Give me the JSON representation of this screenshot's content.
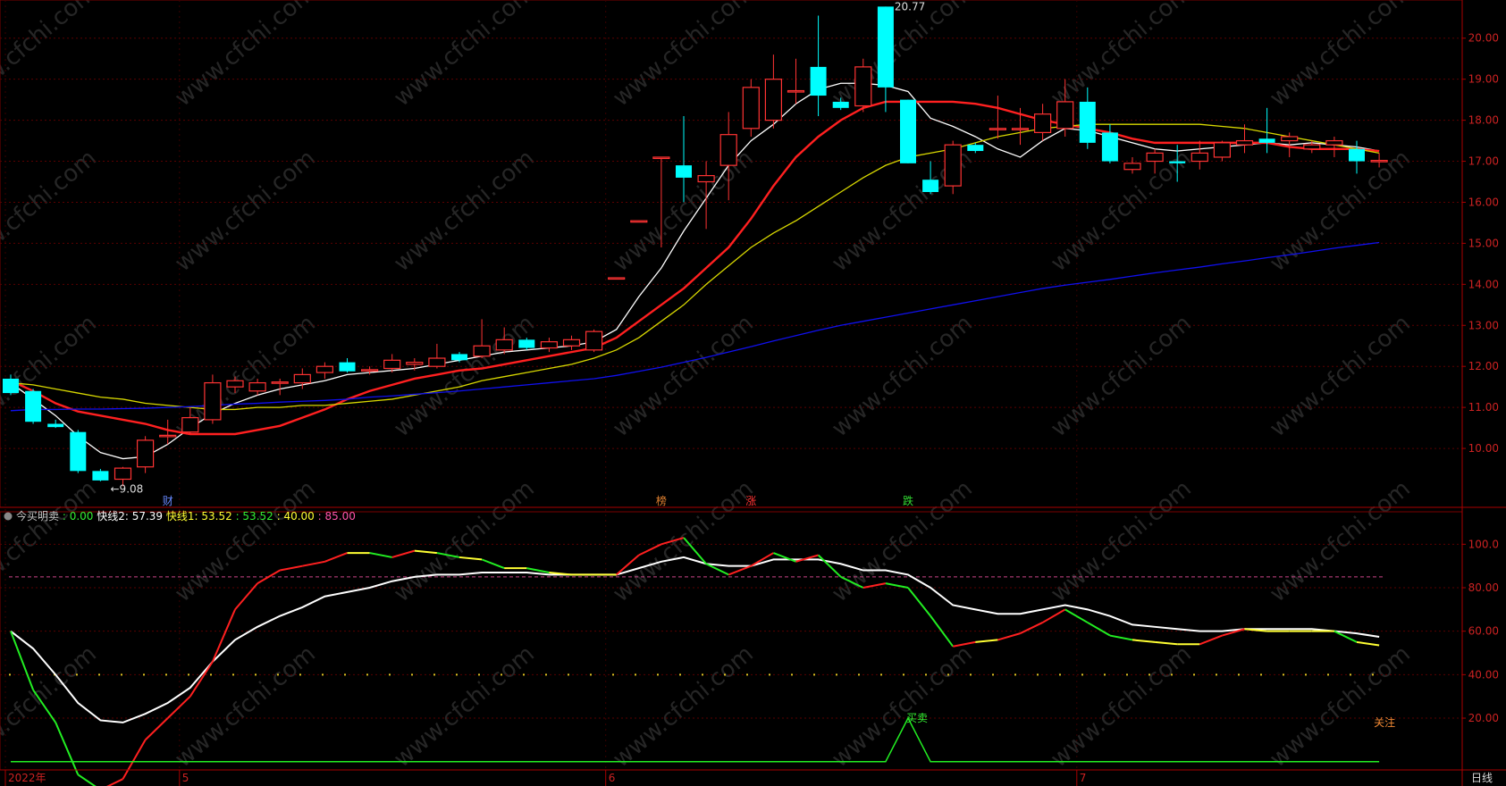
{
  "watermark": "www.cfchi.com",
  "chart_data": [
    {
      "type": "candlestick",
      "yaxis": {
        "ticks": [
          "20.00",
          "19.00",
          "18.00",
          "17.00",
          "16.00",
          "15.00",
          "14.00",
          "13.00",
          "12.00",
          "11.00",
          "10.00"
        ],
        "range": [
          9.0,
          20.8
        ]
      },
      "up_color": "#ff3333",
      "down_color": "#00ffff",
      "candles": [
        {
          "o": 11.7,
          "h": 11.8,
          "l": 11.3,
          "c": 11.35
        },
        {
          "o": 11.4,
          "h": 11.45,
          "l": 10.6,
          "c": 10.65
        },
        {
          "o": 10.6,
          "h": 10.7,
          "l": 10.5,
          "c": 10.52
        },
        {
          "o": 10.4,
          "h": 10.45,
          "l": 9.4,
          "c": 9.45
        },
        {
          "o": 9.45,
          "h": 9.5,
          "l": 9.2,
          "c": 9.22
        },
        {
          "o": 9.25,
          "h": 9.55,
          "l": 9.08,
          "c": 9.52
        },
        {
          "o": 9.55,
          "h": 10.3,
          "l": 9.4,
          "c": 10.2
        },
        {
          "o": 10.3,
          "h": 10.7,
          "l": 10.1,
          "c": 10.32
        },
        {
          "o": 10.4,
          "h": 11.0,
          "l": 10.35,
          "c": 10.75
        },
        {
          "o": 10.7,
          "h": 11.8,
          "l": 10.6,
          "c": 11.6
        },
        {
          "o": 11.5,
          "h": 11.75,
          "l": 11.35,
          "c": 11.65
        },
        {
          "o": 11.4,
          "h": 11.7,
          "l": 11.3,
          "c": 11.6
        },
        {
          "o": 11.6,
          "h": 11.7,
          "l": 11.3,
          "c": 11.62
        },
        {
          "o": 11.6,
          "h": 11.95,
          "l": 11.45,
          "c": 11.8
        },
        {
          "o": 11.85,
          "h": 12.1,
          "l": 11.7,
          "c": 12.0
        },
        {
          "o": 12.1,
          "h": 12.2,
          "l": 11.85,
          "c": 11.88
        },
        {
          "o": 11.9,
          "h": 12.0,
          "l": 11.8,
          "c": 11.92
        },
        {
          "o": 11.95,
          "h": 12.3,
          "l": 11.85,
          "c": 12.15
        },
        {
          "o": 12.05,
          "h": 12.2,
          "l": 11.9,
          "c": 12.1
        },
        {
          "o": 12.0,
          "h": 12.55,
          "l": 11.95,
          "c": 12.2
        },
        {
          "o": 12.3,
          "h": 12.35,
          "l": 12.1,
          "c": 12.15
        },
        {
          "o": 12.25,
          "h": 13.15,
          "l": 12.2,
          "c": 12.5
        },
        {
          "o": 12.4,
          "h": 12.95,
          "l": 12.3,
          "c": 12.65
        },
        {
          "o": 12.65,
          "h": 12.7,
          "l": 12.4,
          "c": 12.45
        },
        {
          "o": 12.45,
          "h": 12.7,
          "l": 12.35,
          "c": 12.6
        },
        {
          "o": 12.5,
          "h": 12.75,
          "l": 12.4,
          "c": 12.65
        },
        {
          "o": 12.4,
          "h": 12.9,
          "l": 12.35,
          "c": 12.85
        },
        {
          "o": 14.16,
          "h": 14.16,
          "l": 14.16,
          "c": 14.16
        },
        {
          "o": 15.55,
          "h": 15.55,
          "l": 15.55,
          "c": 15.55
        },
        {
          "o": 17.1,
          "h": 17.1,
          "l": 14.9,
          "c": 17.1
        },
        {
          "o": 16.9,
          "h": 18.1,
          "l": 16.0,
          "c": 16.6
        },
        {
          "o": 16.5,
          "h": 17.0,
          "l": 15.35,
          "c": 16.65
        },
        {
          "o": 16.9,
          "h": 18.2,
          "l": 16.05,
          "c": 17.65
        },
        {
          "o": 17.8,
          "h": 19.0,
          "l": 17.6,
          "c": 18.8
        },
        {
          "o": 18.0,
          "h": 19.6,
          "l": 17.8,
          "c": 19.0
        },
        {
          "o": 18.7,
          "h": 19.5,
          "l": 18.4,
          "c": 18.72
        },
        {
          "o": 19.3,
          "h": 20.55,
          "l": 18.1,
          "c": 18.6
        },
        {
          "o": 18.45,
          "h": 18.55,
          "l": 18.25,
          "c": 18.3
        },
        {
          "o": 18.35,
          "h": 19.5,
          "l": 18.2,
          "c": 19.3
        },
        {
          "o": 20.77,
          "h": 20.77,
          "l": 18.2,
          "c": 18.8
        },
        {
          "o": 18.5,
          "h": 18.5,
          "l": 16.95,
          "c": 16.95
        },
        {
          "o": 16.55,
          "h": 17.0,
          "l": 16.2,
          "c": 16.25
        },
        {
          "o": 16.4,
          "h": 17.5,
          "l": 16.2,
          "c": 17.4
        },
        {
          "o": 17.4,
          "h": 17.45,
          "l": 17.2,
          "c": 17.25
        },
        {
          "o": 17.8,
          "h": 18.6,
          "l": 17.55,
          "c": 17.8
        },
        {
          "o": 17.8,
          "h": 18.3,
          "l": 17.4,
          "c": 17.8
        },
        {
          "o": 17.7,
          "h": 18.4,
          "l": 17.5,
          "c": 18.15
        },
        {
          "o": 17.8,
          "h": 19.0,
          "l": 17.6,
          "c": 18.45
        },
        {
          "o": 18.45,
          "h": 18.8,
          "l": 17.3,
          "c": 17.45
        },
        {
          "o": 17.7,
          "h": 17.9,
          "l": 16.95,
          "c": 17.0
        },
        {
          "o": 16.8,
          "h": 17.1,
          "l": 16.7,
          "c": 16.95
        },
        {
          "o": 17.0,
          "h": 17.3,
          "l": 16.7,
          "c": 17.2
        },
        {
          "o": 17.0,
          "h": 17.4,
          "l": 16.5,
          "c": 16.95
        },
        {
          "o": 17.0,
          "h": 17.5,
          "l": 16.8,
          "c": 17.2
        },
        {
          "o": 17.1,
          "h": 17.5,
          "l": 17.0,
          "c": 17.45
        },
        {
          "o": 17.4,
          "h": 17.9,
          "l": 17.2,
          "c": 17.5
        },
        {
          "o": 17.55,
          "h": 18.3,
          "l": 17.2,
          "c": 17.45
        },
        {
          "o": 17.5,
          "h": 17.7,
          "l": 17.1,
          "c": 17.6
        },
        {
          "o": 17.3,
          "h": 17.5,
          "l": 17.2,
          "c": 17.4
        },
        {
          "o": 17.4,
          "h": 17.6,
          "l": 17.1,
          "c": 17.5
        },
        {
          "o": 17.3,
          "h": 17.5,
          "l": 16.7,
          "c": 17.0
        },
        {
          "o": 17.0,
          "h": 17.2,
          "l": 16.85,
          "c": 17.02
        }
      ],
      "series": [
        {
          "color": "#ffffff",
          "values": [
            11.6,
            11.2,
            10.8,
            10.3,
            9.9,
            9.75,
            9.8,
            10.1,
            10.5,
            10.85,
            11.1,
            11.3,
            11.45,
            11.55,
            11.65,
            11.8,
            11.85,
            11.9,
            11.95,
            12.05,
            12.15,
            12.25,
            12.35,
            12.4,
            12.45,
            12.5,
            12.6,
            12.9,
            13.7,
            14.4,
            15.3,
            16.1,
            16.9,
            17.5,
            17.9,
            18.4,
            18.75,
            18.9,
            18.9,
            18.85,
            18.7,
            18.05,
            17.85,
            17.6,
            17.3,
            17.1,
            17.5,
            17.8,
            17.75,
            17.6,
            17.45,
            17.3,
            17.25,
            17.3,
            17.35,
            17.4,
            17.45,
            17.4,
            17.45,
            17.4,
            17.35,
            17.25
          ]
        },
        {
          "color": "#ff2020",
          "values": [
            11.65,
            11.4,
            11.1,
            10.9,
            10.8,
            10.7,
            10.6,
            10.45,
            10.35,
            10.35,
            10.35,
            10.45,
            10.55,
            10.75,
            10.95,
            11.2,
            11.4,
            11.55,
            11.7,
            11.8,
            11.9,
            11.95,
            12.05,
            12.15,
            12.25,
            12.35,
            12.45,
            12.7,
            13.1,
            13.5,
            13.9,
            14.4,
            14.9,
            15.6,
            16.4,
            17.1,
            17.6,
            18.0,
            18.3,
            18.45,
            18.45,
            18.45,
            18.45,
            18.4,
            18.3,
            18.15,
            18.0,
            17.9,
            17.8,
            17.7,
            17.55,
            17.45,
            17.45,
            17.45,
            17.45,
            17.45,
            17.45,
            17.35,
            17.3,
            17.3,
            17.3,
            17.25
          ]
        },
        {
          "color": "#d8d800",
          "values": [
            11.6,
            11.55,
            11.45,
            11.35,
            11.25,
            11.2,
            11.1,
            11.05,
            11.0,
            10.95,
            10.95,
            11.0,
            11.0,
            11.05,
            11.05,
            11.1,
            11.15,
            11.2,
            11.3,
            11.4,
            11.5,
            11.65,
            11.75,
            11.85,
            11.95,
            12.05,
            12.2,
            12.4,
            12.7,
            13.1,
            13.5,
            14.0,
            14.45,
            14.9,
            15.25,
            15.55,
            15.9,
            16.25,
            16.6,
            16.9,
            17.1,
            17.2,
            17.3,
            17.45,
            17.6,
            17.7,
            17.8,
            17.85,
            17.9,
            17.9,
            17.9,
            17.9,
            17.9,
            17.9,
            17.85,
            17.8,
            17.7,
            17.6,
            17.5,
            17.4,
            17.3,
            17.2
          ]
        },
        {
          "color": "#1010ee",
          "values": [
            10.92,
            10.95,
            10.95,
            10.96,
            10.96,
            10.97,
            10.98,
            11.0,
            11.02,
            11.05,
            11.08,
            11.1,
            11.13,
            11.15,
            11.17,
            11.2,
            11.25,
            11.28,
            11.32,
            11.36,
            11.4,
            11.45,
            11.5,
            11.55,
            11.6,
            11.65,
            11.7,
            11.78,
            11.88,
            11.98,
            12.1,
            12.22,
            12.35,
            12.48,
            12.62,
            12.75,
            12.88,
            13.0,
            13.1,
            13.2,
            13.3,
            13.4,
            13.5,
            13.6,
            13.7,
            13.8,
            13.9,
            13.98,
            14.05,
            14.12,
            14.2,
            14.28,
            14.35,
            14.42,
            14.5,
            14.57,
            14.65,
            14.72,
            14.8,
            14.88,
            14.95,
            15.02
          ]
        }
      ],
      "annotations": [
        {
          "text": "20.77",
          "index": 39,
          "value": 20.77
        },
        {
          "text": "←9.08",
          "index": 5,
          "value": 9.08
        }
      ],
      "event_markers": [
        {
          "text": "财",
          "index": 7,
          "color": "#6688ff"
        },
        {
          "text": "榜",
          "index": 29,
          "color": "#e08030"
        },
        {
          "text": "涨",
          "index": 33,
          "color": "#ff3333"
        },
        {
          "text": "跌",
          "index": 40,
          "color": "#33dd33"
        }
      ]
    },
    {
      "type": "line",
      "title": "今买明卖",
      "legend": [
        {
          "text": "今买明卖",
          "color": "#c8c8c8"
        },
        {
          "text": ": 0.00",
          "color": "#33ee33"
        },
        {
          "text": "快线2: 57.39",
          "color": "#ffffff"
        },
        {
          "text": "快线1: 53.52",
          "color": "#ffff33"
        },
        {
          "text": ": 53.52",
          "color": "#33ee33"
        },
        {
          "text": ": 40.00",
          "color": "#ffff33"
        },
        {
          "text": ": 85.00",
          "color": "#ff55aa"
        }
      ],
      "yaxis": {
        "ticks": [
          "100.0",
          "80.00",
          "60.00",
          "40.00",
          "20.00"
        ],
        "range": [
          -3,
          110
        ]
      },
      "series": [
        {
          "name": "快线2",
          "color": "#ffffff",
          "values": [
            60,
            52,
            40,
            27,
            19,
            18,
            22,
            27,
            34,
            46,
            56,
            62,
            67,
            71,
            76,
            78,
            80,
            83,
            85,
            86,
            86,
            87,
            87,
            87,
            86,
            86,
            86,
            86,
            89,
            92,
            94,
            91,
            90,
            90,
            93,
            93,
            93,
            91,
            88,
            88,
            86,
            80,
            72,
            70,
            68,
            68,
            70,
            72,
            70,
            67,
            63,
            62,
            61,
            60,
            60,
            61,
            61,
            61,
            61,
            60,
            59,
            57.39
          ]
        },
        {
          "name": "快线1",
          "values": [
            60,
            33,
            18,
            -6,
            -13,
            -8,
            10,
            20,
            30,
            46,
            70,
            82,
            88,
            90,
            92,
            96,
            96,
            94,
            97,
            96,
            94,
            93,
            89,
            89,
            87,
            86,
            86,
            86,
            95,
            100,
            103,
            91,
            86,
            90,
            96,
            92,
            95,
            85,
            80,
            82,
            80,
            67,
            53,
            55,
            56,
            59,
            64,
            70,
            64,
            58,
            56,
            55,
            54,
            54,
            58,
            61,
            60,
            60,
            60,
            60,
            55,
            53.52
          ],
          "segment_colors": {
            "up": "#ff2020",
            "flat": "#ffff33",
            "down": "#22ee22"
          }
        },
        {
          "name": "买卖",
          "color": "#22ee22",
          "values": [
            0,
            0,
            0,
            0,
            0,
            0,
            0,
            0,
            0,
            0,
            0,
            0,
            0,
            0,
            0,
            0,
            0,
            0,
            0,
            0,
            0,
            0,
            0,
            0,
            0,
            0,
            0,
            0,
            0,
            0,
            0,
            0,
            0,
            0,
            0,
            0,
            0,
            0,
            0,
            0,
            20,
            0,
            0,
            0,
            0,
            0,
            0,
            0,
            0,
            0,
            0,
            0,
            0,
            0,
            0,
            0,
            0,
            0,
            0,
            0,
            0,
            0
          ]
        }
      ],
      "reference_lines": [
        {
          "value": 85,
          "color": "#cc4488",
          "style": "dashed"
        },
        {
          "value": 40,
          "color": "#e0c020",
          "style": "dotted"
        }
      ],
      "annotations": [
        {
          "text": "买卖",
          "index": 40,
          "value": 20,
          "color": "#33ee33"
        },
        {
          "text": "关注",
          "index": 61,
          "value": 18,
          "color": "#ee8833"
        }
      ]
    }
  ],
  "xaxis": {
    "labels": [
      {
        "text": "2022年",
        "index": 1
      },
      {
        "text": "5",
        "index": 8
      },
      {
        "text": "6",
        "index": 27
      },
      {
        "text": "7",
        "index": 48
      }
    ]
  },
  "period_label": "日线"
}
